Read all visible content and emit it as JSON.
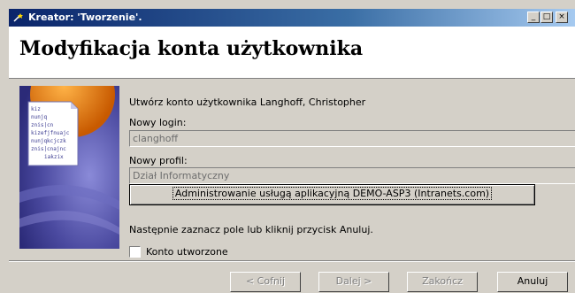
{
  "window": {
    "title": "Kreator: 'Tworzenie'.",
    "controls": [
      "_",
      "□",
      "×"
    ]
  },
  "header": {
    "title": "Modyfikacja konta użytkownika"
  },
  "art": {
    "lines": [
      "kiz",
      "nunjq",
      "znis|cn",
      "kizefjfnuajc",
      "nunjqkcjczk",
      "znis|cnajnc",
      "iakzix"
    ]
  },
  "main": {
    "intro": "Utwórz konto użytkownika Langhoff, Christopher",
    "login_label": "Nowy login:",
    "login_value": "clanghoff",
    "profile_label": "Nowy profil:",
    "profile_value": "Dział Informatyczny",
    "admin_button": "Administrowanie usługą aplikacyjną DEMO-ASP3 (Intranets.com)",
    "instruction": "Następnie zaznacz pole lub kliknij przycisk Anuluj.",
    "checkbox_label": "Konto utworzone",
    "checkbox_checked": false
  },
  "footer": {
    "back": "< Cofnij",
    "next": "Dalej >",
    "finish": "Zakończ",
    "cancel": "Anuluj"
  },
  "colors": {
    "title_start": "#0a246a",
    "title_end": "#a6caf0",
    "face": "#d4d0c8",
    "art_bg": "#4b4aa0",
    "art_orange": "#e07a10"
  }
}
